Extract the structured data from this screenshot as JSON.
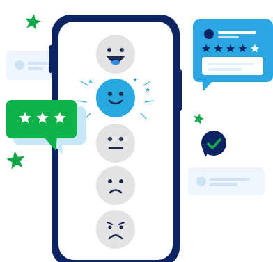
{
  "illustration": {
    "emotion_scale": [
      {
        "mood": "very-happy",
        "selected": false
      },
      {
        "mood": "happy",
        "selected": true
      },
      {
        "mood": "neutral",
        "selected": false
      },
      {
        "mood": "sad",
        "selected": false
      },
      {
        "mood": "very-sad",
        "selected": false
      }
    ],
    "star_rating_bubble": {
      "stars_shown": 3,
      "max_stars": 3
    },
    "review_card": {
      "stars_filled": 4,
      "max_stars": 5
    },
    "check_badge": {
      "icon": "check-icon"
    },
    "decorative_stars": [
      "star-icon",
      "star-icon",
      "star-icon"
    ]
  },
  "colors": {
    "phone_frame": "#0c2462",
    "phone_screen": "#ffffff",
    "emoji_inactive": "#e3e3e3",
    "emoji_active": "#29a8e0",
    "face_ink": "#1b2a4e",
    "tongue": "#2f8fe8",
    "green": "#0fb24a",
    "green_star": "#13a64a",
    "blue_card": "#2aa7e3",
    "faint_card": "#eef5fd",
    "faint_line": "#cfe3f7",
    "pale_blue": "#dff0fc",
    "star_navy": "#0c2462"
  }
}
